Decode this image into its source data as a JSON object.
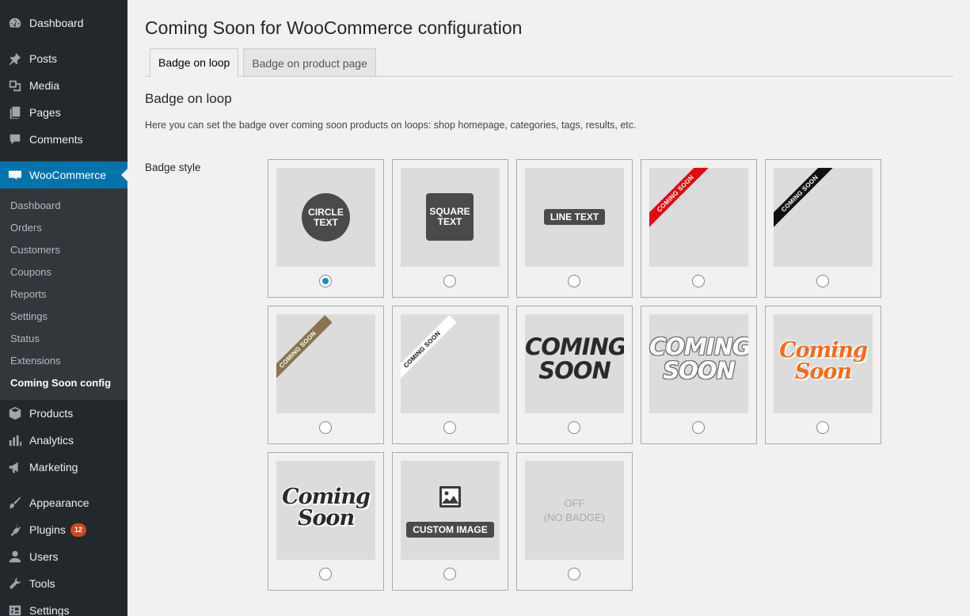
{
  "sidebar": {
    "items": [
      {
        "label": "Dashboard",
        "icon": "dashboard-icon"
      },
      {
        "label": "Posts",
        "icon": "pin-icon"
      },
      {
        "label": "Media",
        "icon": "media-icon"
      },
      {
        "label": "Pages",
        "icon": "pages-icon"
      },
      {
        "label": "Comments",
        "icon": "comment-icon"
      },
      {
        "label": "WooCommerce",
        "icon": "woocommerce-icon"
      },
      {
        "label": "Products",
        "icon": "box-icon"
      },
      {
        "label": "Analytics",
        "icon": "bar-chart-icon"
      },
      {
        "label": "Marketing",
        "icon": "megaphone-icon"
      },
      {
        "label": "Appearance",
        "icon": "brush-icon"
      },
      {
        "label": "Plugins",
        "icon": "plug-icon",
        "count": "12"
      },
      {
        "label": "Users",
        "icon": "user-icon"
      },
      {
        "label": "Tools",
        "icon": "wrench-icon"
      },
      {
        "label": "Settings",
        "icon": "settings-icon"
      }
    ],
    "woo_submenu": [
      "Dashboard",
      "Orders",
      "Customers",
      "Coupons",
      "Reports",
      "Settings",
      "Status",
      "Extensions",
      "Coming Soon config"
    ]
  },
  "page": {
    "title": "Coming Soon for WooCommerce configuration",
    "tabs": [
      "Badge on loop",
      "Badge on product page"
    ],
    "section_title": "Badge on loop",
    "section_desc": "Here you can set the badge over coming soon products on loops: shop homepage, categories, tags, results, etc.",
    "field_label": "Badge style"
  },
  "badges": {
    "circle": "CIRCLE TEXT",
    "square": "SQUARE TEXT",
    "line": "LINE TEXT",
    "ribbon": "COMING SOON",
    "big_line1": "COMING",
    "big_line2": "SOON",
    "script_line1": "Coming",
    "script_line2": "Soon",
    "custom": "CUSTOM IMAGE",
    "off_line1": "OFF",
    "off_line2": "(NO BADGE)",
    "selected_index": 0
  },
  "colors": {
    "accent": "#0073aa",
    "ribbon_red": "#e30613",
    "ribbon_black": "#111111",
    "ribbon_brown": "#8a7350",
    "ribbon_white": "#ffffff",
    "orange": "#f36c21",
    "plugins_badge": "#ca4a1f"
  }
}
